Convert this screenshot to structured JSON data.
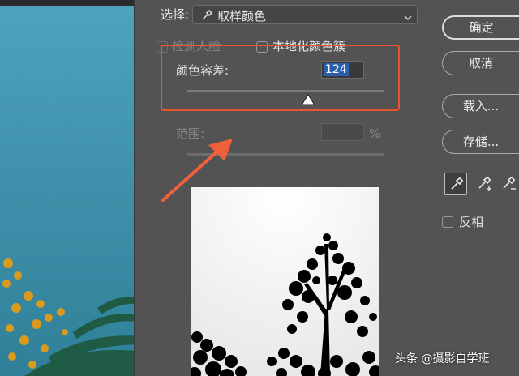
{
  "select": {
    "label": "选择:",
    "value": "取样颜色"
  },
  "detect_faces": {
    "label": "检测人脸",
    "checked": false,
    "enabled": false
  },
  "localized_clusters": {
    "label": "本地化颜色簇",
    "checked": false
  },
  "tolerance": {
    "label": "颜色容差:",
    "value": "124",
    "max": 200
  },
  "range": {
    "label": "范围:",
    "value": "",
    "unit": "%",
    "enabled": false
  },
  "buttons": {
    "ok": "确定",
    "cancel": "取消",
    "load": "载入...",
    "save": "存储..."
  },
  "invert": {
    "label": "反相",
    "checked": false
  },
  "watermark": {
    "prefix": "头条",
    "handle": "@摄影自学班"
  },
  "colors": {
    "dialog_bg": "#535353",
    "highlight_border": "#e8552e",
    "annotation_arrow": "#f0603a",
    "selection_blue": "#2c5fae"
  },
  "icons": [
    "eyedropper-icon",
    "eyedropper-plus-icon",
    "eyedropper-minus-icon",
    "chevron-down-icon"
  ]
}
